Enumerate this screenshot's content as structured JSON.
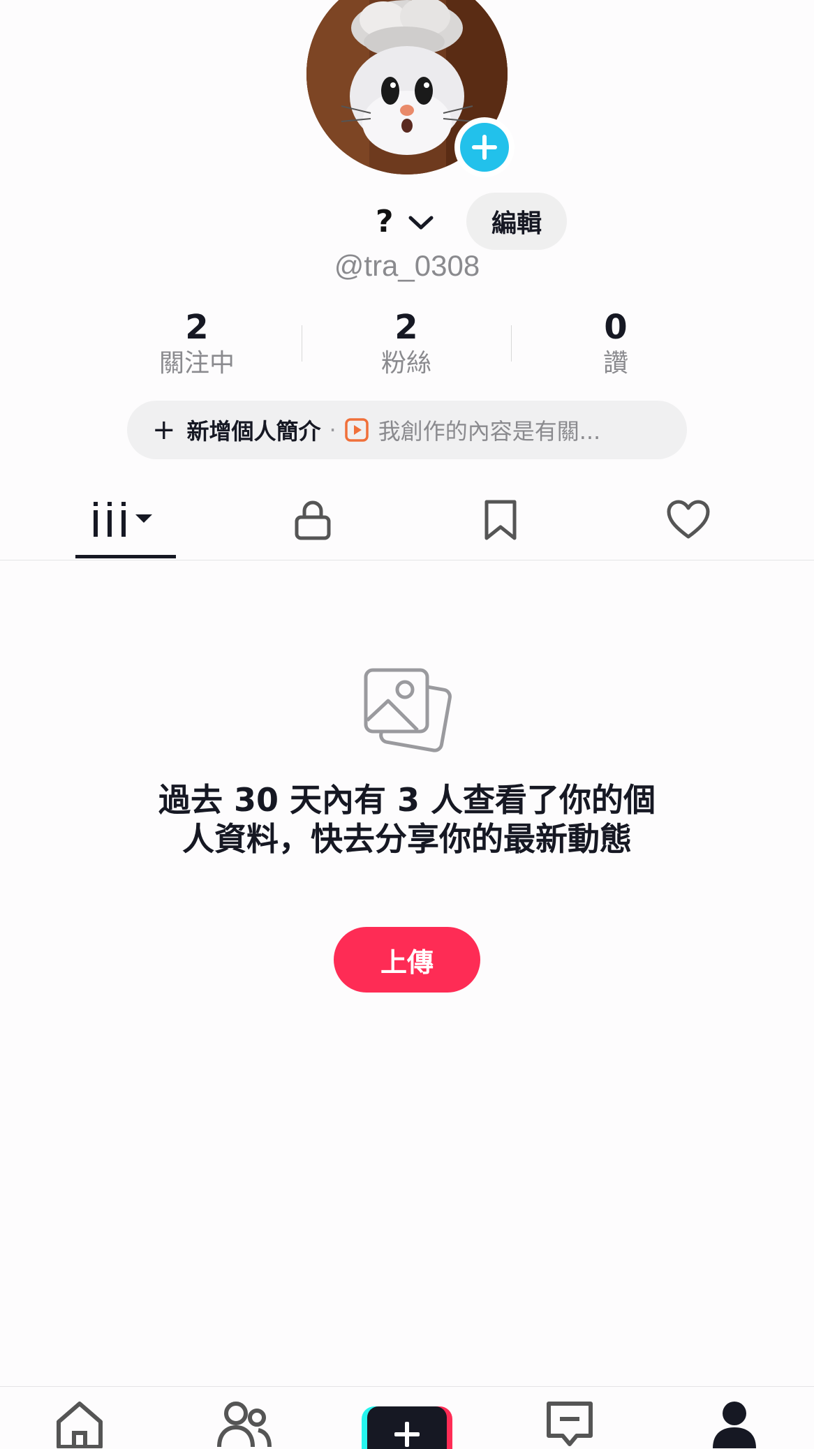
{
  "profile": {
    "display_name": "?",
    "edit_label": "編輯",
    "username": "@tra_0308"
  },
  "stats": [
    {
      "value": "2",
      "label": "關注中"
    },
    {
      "value": "2",
      "label": "粉絲"
    },
    {
      "value": "0",
      "label": "讚"
    }
  ],
  "bio": {
    "plus": "+",
    "add_label": "新增個人簡介",
    "separator": "·",
    "content_label": "我創作的內容是有關..."
  },
  "tabs": [
    {
      "icon": "videos-grid-icon",
      "active": true
    },
    {
      "icon": "lock-icon",
      "active": false
    },
    {
      "icon": "bookmark-icon",
      "active": false
    },
    {
      "icon": "heart-icon",
      "active": false
    }
  ],
  "empty_state": {
    "icon": "photos-icon",
    "message": "過去 30 天內有 3 人查看了你的個人資料，快去分享你的最新動態",
    "upload_label": "上傳"
  },
  "bottom_nav": [
    {
      "icon": "home-icon"
    },
    {
      "icon": "friends-icon"
    },
    {
      "icon": "create-plus-icon"
    },
    {
      "icon": "inbox-icon"
    },
    {
      "icon": "profile-icon",
      "active": true
    }
  ],
  "colors": {
    "accent_red": "#fe2c55",
    "accent_cyan": "#25f4ee",
    "avatar_add_blue": "#22c1eb",
    "text_primary": "#161823",
    "text_secondary": "#8a8a8e"
  }
}
